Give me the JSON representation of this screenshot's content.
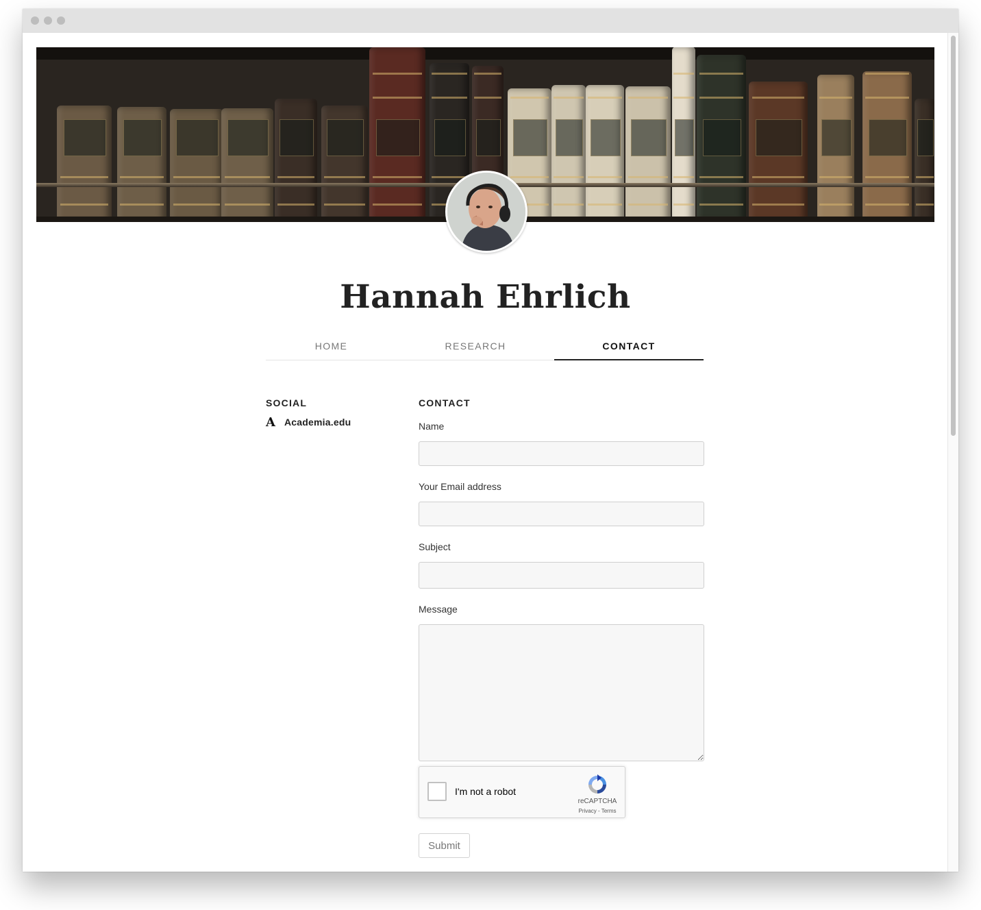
{
  "profile": {
    "name": "Hannah Ehrlich"
  },
  "nav": {
    "tabs": [
      {
        "label": "HOME",
        "active": false
      },
      {
        "label": "RESEARCH",
        "active": false
      },
      {
        "label": "CONTACT",
        "active": true
      }
    ]
  },
  "social": {
    "title": "SOCIAL",
    "links": [
      {
        "icon": "academia-icon",
        "glyph": "A",
        "label": "Academia.edu"
      }
    ]
  },
  "contact": {
    "title": "CONTACT",
    "fields": {
      "name_label": "Name",
      "name_value": "",
      "email_label": "Your Email address",
      "email_value": "",
      "subject_label": "Subject",
      "subject_value": "",
      "message_label": "Message",
      "message_value": ""
    },
    "recaptcha": {
      "checkbox_label": "I'm not a robot",
      "brand": "reCAPTCHA",
      "privacy": "Privacy",
      "separator": " - ",
      "terms": "Terms"
    },
    "submit_label": "Submit"
  },
  "colors": {
    "active_tab": "#111111",
    "inactive_tab": "#777777",
    "field_bg": "#f7f7f7",
    "banner_dark": "#2a2520"
  }
}
